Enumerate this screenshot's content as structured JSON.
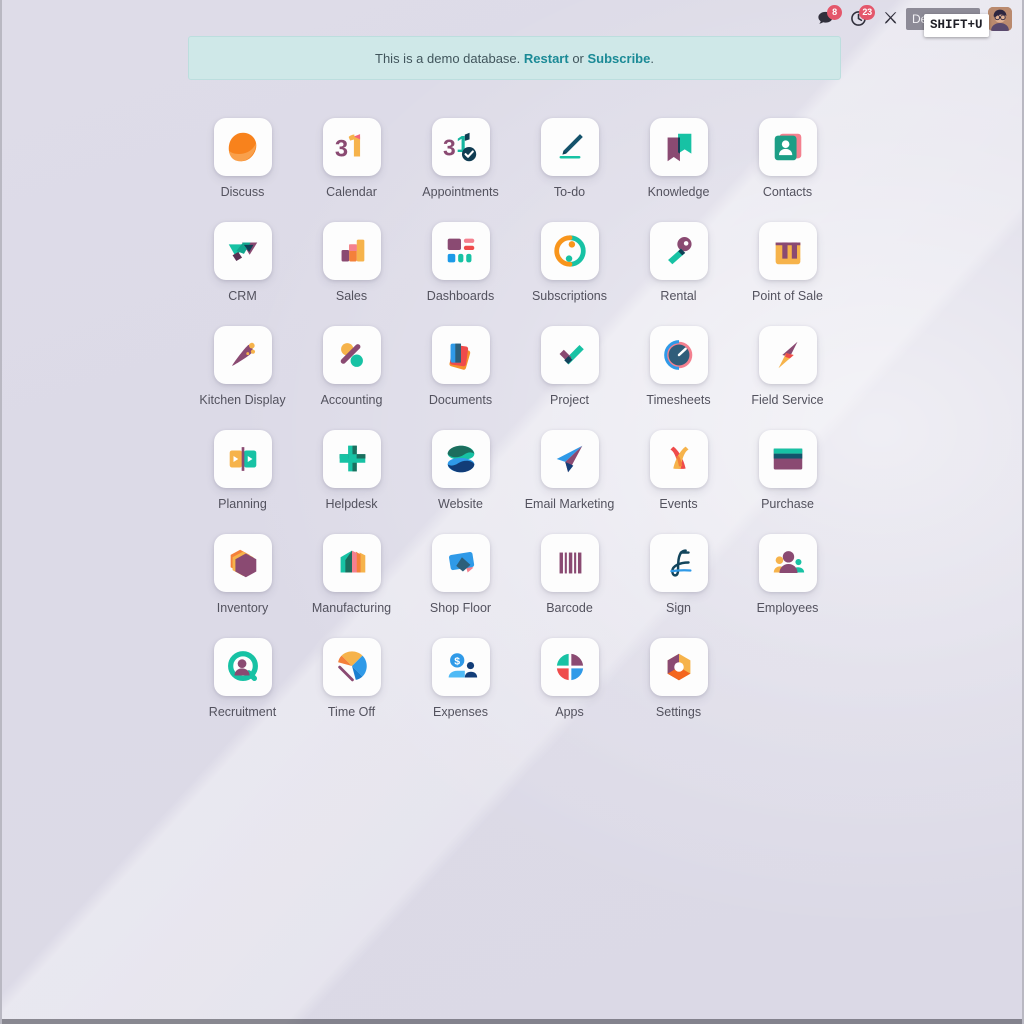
{
  "navbar": {
    "messages_icon": "chat-bubble-icon",
    "messages_count": "8",
    "activities_icon": "clock-icon",
    "activities_count": "23",
    "developer_icon": "tools-icon",
    "company_name": "Demo Company",
    "keyboard_shortcut": "SHIFT+U",
    "avatar_alt": "user-avatar"
  },
  "banner": {
    "text": "This is a demo database.",
    "restart_label": "Restart",
    "or_label": "or",
    "subscribe_label": "Subscribe",
    "period": "."
  },
  "apps": [
    {
      "label": "Discuss",
      "icon": "discuss-icon"
    },
    {
      "label": "Calendar",
      "icon": "calendar-icon"
    },
    {
      "label": "Appointments",
      "icon": "appointments-icon"
    },
    {
      "label": "To-do",
      "icon": "todo-icon"
    },
    {
      "label": "Knowledge",
      "icon": "knowledge-icon"
    },
    {
      "label": "Contacts",
      "icon": "contacts-icon"
    },
    {
      "label": "CRM",
      "icon": "crm-icon"
    },
    {
      "label": "Sales",
      "icon": "sales-icon"
    },
    {
      "label": "Dashboards",
      "icon": "dashboards-icon"
    },
    {
      "label": "Subscriptions",
      "icon": "subscriptions-icon"
    },
    {
      "label": "Rental",
      "icon": "rental-icon"
    },
    {
      "label": "Point of Sale",
      "icon": "point-of-sale-icon"
    },
    {
      "label": "Kitchen Display",
      "icon": "kitchen-display-icon"
    },
    {
      "label": "Accounting",
      "icon": "accounting-icon"
    },
    {
      "label": "Documents",
      "icon": "documents-icon"
    },
    {
      "label": "Project",
      "icon": "project-icon"
    },
    {
      "label": "Timesheets",
      "icon": "timesheets-icon"
    },
    {
      "label": "Field Service",
      "icon": "field-service-icon"
    },
    {
      "label": "Planning",
      "icon": "planning-icon"
    },
    {
      "label": "Helpdesk",
      "icon": "helpdesk-icon"
    },
    {
      "label": "Website",
      "icon": "website-icon"
    },
    {
      "label": "Email Marketing",
      "icon": "email-marketing-icon"
    },
    {
      "label": "Events",
      "icon": "events-icon"
    },
    {
      "label": "Purchase",
      "icon": "purchase-icon"
    },
    {
      "label": "Inventory",
      "icon": "inventory-icon"
    },
    {
      "label": "Manufacturing",
      "icon": "manufacturing-icon"
    },
    {
      "label": "Shop Floor",
      "icon": "shop-floor-icon"
    },
    {
      "label": "Barcode",
      "icon": "barcode-icon"
    },
    {
      "label": "Sign",
      "icon": "sign-icon"
    },
    {
      "label": "Employees",
      "icon": "employees-icon"
    },
    {
      "label": "Recruitment",
      "icon": "recruitment-icon"
    },
    {
      "label": "Time Off",
      "icon": "time-off-icon"
    },
    {
      "label": "Expenses",
      "icon": "expenses-icon"
    },
    {
      "label": "Apps",
      "icon": "apps-icon"
    },
    {
      "label": "Settings",
      "icon": "settings-icon"
    }
  ],
  "colors": {
    "badge": "#e4576b",
    "banner_bg": "#cfe8e8",
    "banner_link": "#1b8a96",
    "desktop_bg": "#dcdae7",
    "tile_bg": "#fdfdfd",
    "label_text": "#53525e"
  }
}
